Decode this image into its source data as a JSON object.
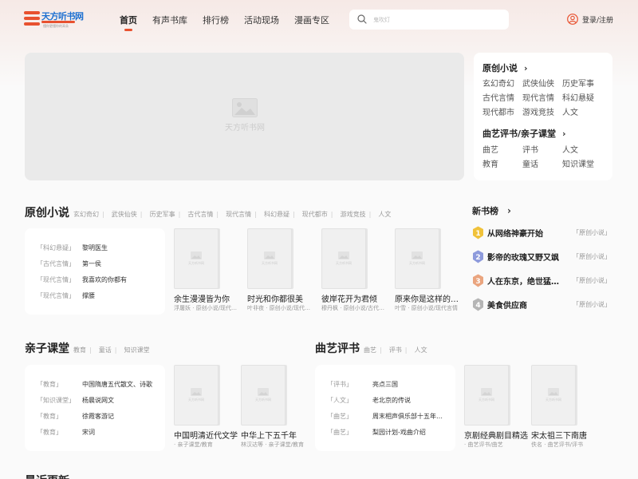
{
  "header": {
    "logo_name": "天方听书网",
    "logo_sub": "懂你更懂你的耳朵",
    "nav": [
      "首页",
      "有声书库",
      "排行榜",
      "活动现场",
      "漫画专区"
    ],
    "search_placeholder": "鬼吹灯",
    "login": "登录/注册"
  },
  "banner": {
    "placeholder": "天方听书网"
  },
  "category_card": {
    "sections": [
      {
        "title": "原创小说",
        "items": [
          "玄幻奇幻",
          "武侠仙侠",
          "历史军事",
          "古代言情",
          "现代言情",
          "科幻悬疑",
          "现代都市",
          "游戏竞技",
          "人文"
        ]
      },
      {
        "title": "曲艺评书/亲子课堂",
        "items": [
          "曲艺",
          "评书",
          "人文",
          "教育",
          "童话",
          "知识课堂"
        ]
      }
    ],
    "chevron": "›"
  },
  "original": {
    "title": "原创小说",
    "tags": [
      "玄幻奇幻",
      "武侠仙侠",
      "历史军事",
      "古代言情",
      "现代言情",
      "科幻悬疑",
      "现代都市",
      "游戏竞技",
      "人文"
    ],
    "list": [
      {
        "cat": "「科幻悬疑」",
        "title": "黎明医生"
      },
      {
        "cat": "「古代言情」",
        "title": "第一侯"
      },
      {
        "cat": "「现代言情」",
        "title": "我喜欢的你都有"
      },
      {
        "cat": "「现代言情」",
        "title": "撑腰"
      }
    ],
    "books": [
      {
        "title": "余生漫漫皆为你",
        "meta": "浮屠妖 · 原创小说/现代言情"
      },
      {
        "title": "时光和你都很美",
        "meta": "叶非夜 · 原创小说/现代言情"
      },
      {
        "title": "彼岸花开为君倾",
        "meta": "穆丹枫 · 原创小说/古代言情"
      },
      {
        "title": "原来你是这样的顾先生",
        "meta": "叶雪 · 原创小说/现代言情"
      }
    ]
  },
  "ranking": {
    "title": "新书榜",
    "chevron": "›",
    "items": [
      {
        "no": "1",
        "title": "从网络神豪开始",
        "cat": "「原创小说」",
        "color": "#f0c23a"
      },
      {
        "no": "2",
        "title": "影帝的玫瑰又野又飒",
        "cat": "「原创小说」",
        "color": "#8e9bdc"
      },
      {
        "no": "3",
        "title": "人在东京，绝世猛龙过江",
        "cat": "「原创小说」",
        "color": "#eaa57f"
      },
      {
        "no": "4",
        "title": "美食供应商",
        "cat": "「原创小说」",
        "color": "#b5b5b5"
      }
    ]
  },
  "kids": {
    "title": "亲子课堂",
    "tags": [
      "教育",
      "童话",
      "知识课堂"
    ],
    "list": [
      {
        "cat": "「教育」",
        "title": "中国隋唐五代散文、诗歌"
      },
      {
        "cat": "「知识课堂」",
        "title": "杨晨说网文"
      },
      {
        "cat": "「教育」",
        "title": "徐霞客游记"
      },
      {
        "cat": "「教育」",
        "title": "宋词"
      }
    ],
    "books": [
      {
        "title": "中国明清近代文学",
        "meta": "· 亲子课堂/教育"
      },
      {
        "title": "中华上下五千年",
        "meta": "林汉达等 · 亲子课堂/教育"
      }
    ]
  },
  "quyi": {
    "title": "曲艺评书",
    "tags": [
      "曲艺",
      "评书",
      "人文"
    ],
    "list": [
      {
        "cat": "「评书」",
        "title": "亮点三国"
      },
      {
        "cat": "「人文」",
        "title": "老北京的传说"
      },
      {
        "cat": "「曲艺」",
        "title": "周末相声俱乐部十五年精选"
      },
      {
        "cat": "「曲艺」",
        "title": "梨园计划-戏曲介绍"
      }
    ],
    "books": [
      {
        "title": "京剧经典剧目精选",
        "meta": "· 曲艺评书/曲艺"
      },
      {
        "title": "宋太祖三下南唐",
        "meta": "佚名 · 曲艺评书/评书"
      }
    ]
  },
  "latest": {
    "title": "最近更新"
  },
  "cover_placeholder": "天方听书网"
}
